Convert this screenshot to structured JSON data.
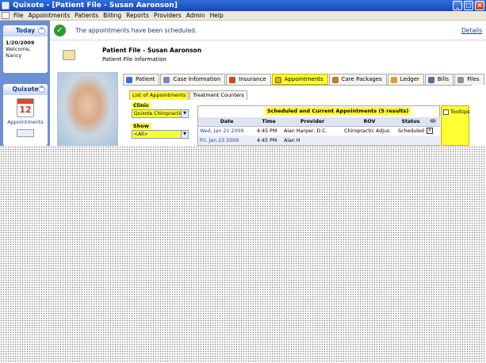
{
  "window": {
    "title": "Quixote - [Patient File - Susan Aaronson]"
  },
  "menu": [
    "File",
    "Appointments",
    "Patients",
    "Billing",
    "Reports",
    "Providers",
    "Admin",
    "Help"
  ],
  "sidebar": {
    "today": {
      "header": "Today",
      "date": "1/20/2009",
      "welcome": "Welcome,",
      "user": "Nancy"
    },
    "quixote": {
      "header": "Quixote",
      "icon_number": "12",
      "item_label": "Appointments"
    }
  },
  "status": {
    "message": "The appointments have been scheduled.",
    "details_link": "Details"
  },
  "patient": {
    "title": "Patient File - Susan Aaronson",
    "subtitle": "Patient File information"
  },
  "tabs": [
    {
      "label": "Patient",
      "icon": "person-icon",
      "color": "#3a6fd0"
    },
    {
      "label": "Case Information",
      "icon": "folder-icon",
      "color": "#7a8ab8"
    },
    {
      "label": "Insurance",
      "icon": "insurance-icon",
      "color": "#d0452a"
    },
    {
      "label": "Appointments",
      "icon": "calendar-icon",
      "color": "#e0b020"
    },
    {
      "label": "Care Packages",
      "icon": "package-icon",
      "color": "#c07a30"
    },
    {
      "label": "Ledger",
      "icon": "ledger-icon",
      "color": "#d6a030"
    },
    {
      "label": "Bills",
      "icon": "bills-icon",
      "color": "#5a6aa0"
    },
    {
      "label": "Files",
      "icon": "files-icon",
      "color": "#909090"
    }
  ],
  "active_tab": "Appointments",
  "subtabs": [
    "List of Appointments",
    "Treatment Counters"
  ],
  "filters": {
    "clinic_label": "Clinic",
    "clinic_value": "Quixote Chiropractic",
    "show_label": "Show",
    "show_value": "<All>"
  },
  "appointments": {
    "title": "Scheduled and Current Appointments (5 results)",
    "tooltips_label": "Tooltips",
    "columns": [
      "Date",
      "Time",
      "Provider",
      "ROV",
      "Status"
    ],
    "rows": [
      {
        "date": "Wed, Jan 21  2009",
        "time": "4:45 PM",
        "provider": "Alan Harper, D.C.",
        "rov": "Chiropractic Adjus",
        "status": "Scheduled"
      },
      {
        "date": "Fri, Jan 23  2009",
        "time": "4:45 PM",
        "provider": "Alan H",
        "rov": "",
        "status": ""
      }
    ]
  }
}
